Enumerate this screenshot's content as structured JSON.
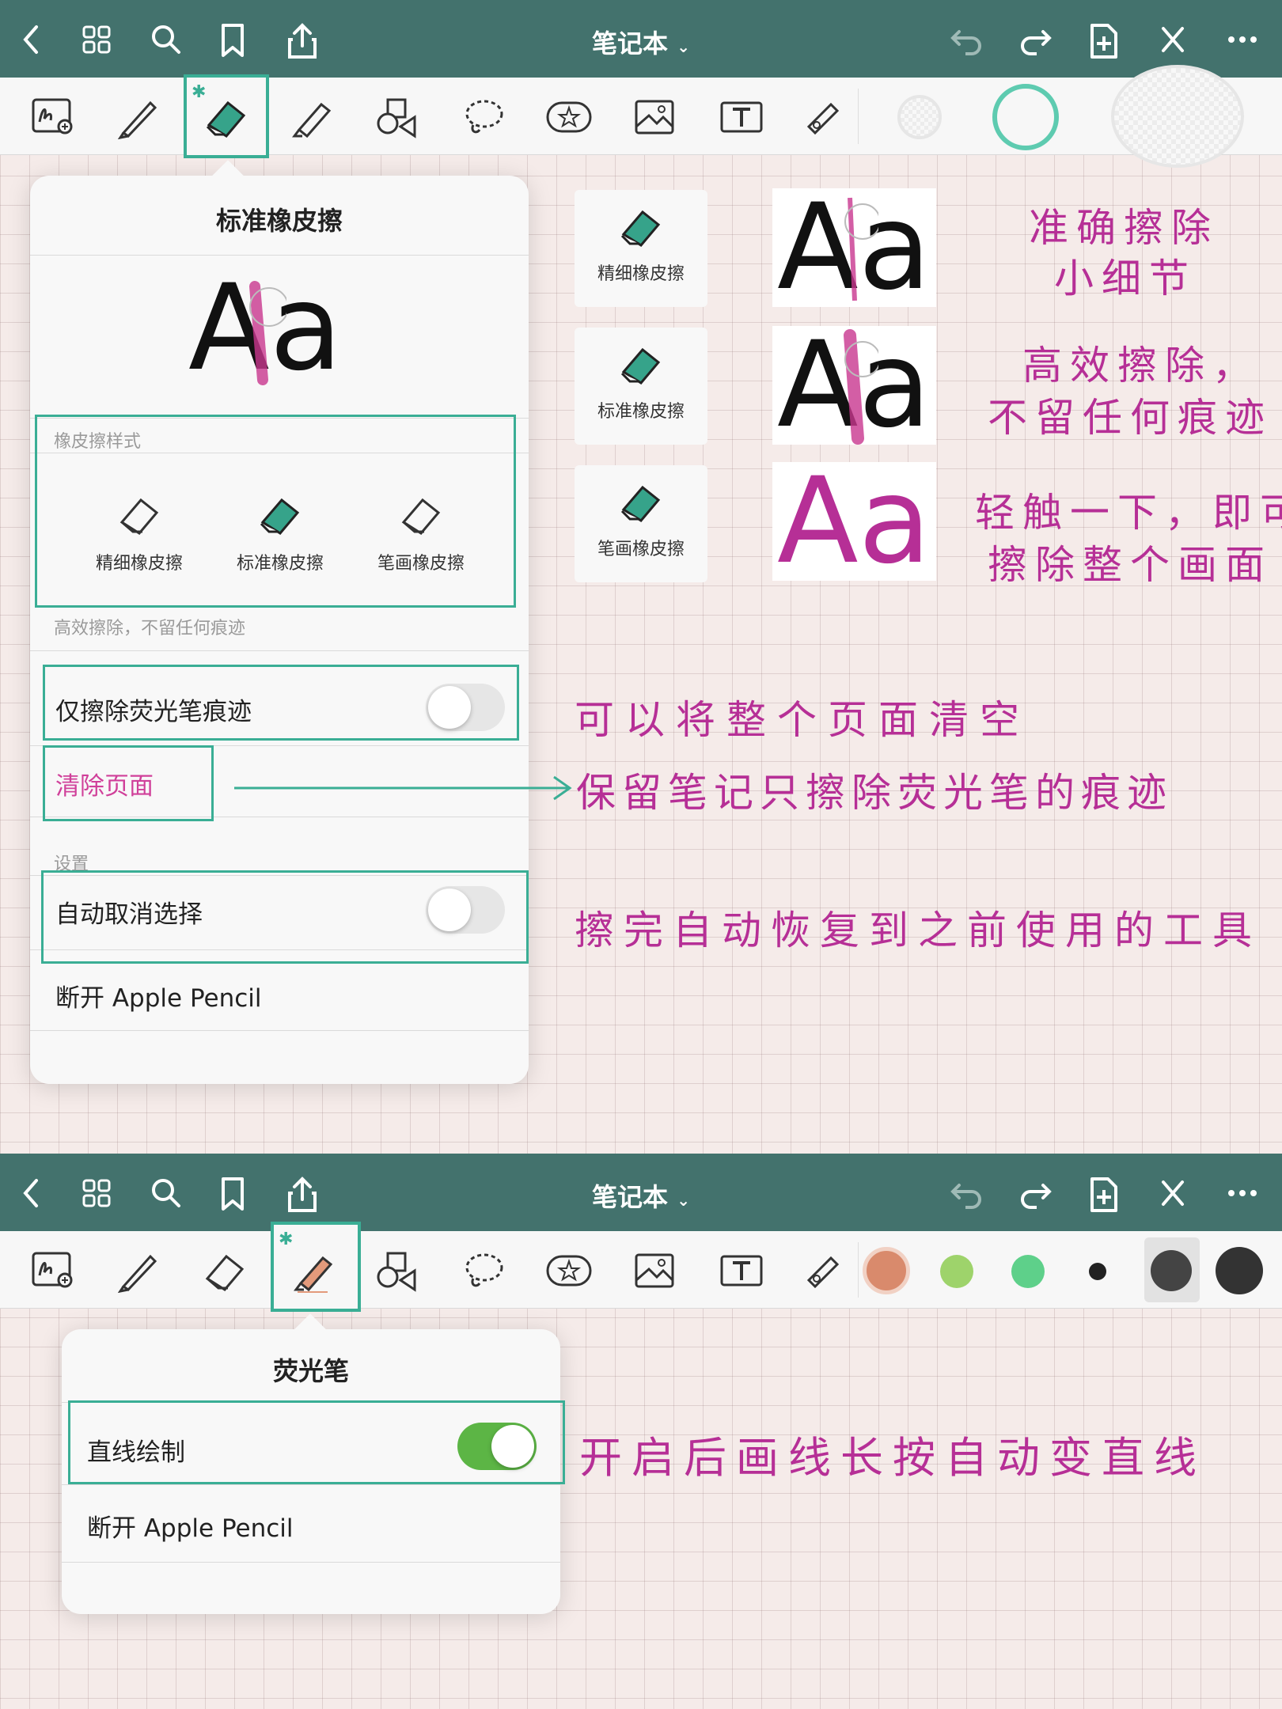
{
  "top": {
    "title": "笔记本",
    "icons": [
      "back-icon",
      "grid-icon",
      "search-icon",
      "bookmark-icon",
      "share-icon",
      "undo-icon",
      "redo-icon",
      "add-page-icon",
      "close-icon",
      "more-icon"
    ]
  },
  "eraser_panel": {
    "title": "标准橡皮擦",
    "preview_text": "Aa",
    "style_section_label": "橡皮擦样式",
    "options": [
      "精细橡皮擦",
      "标准橡皮擦",
      "笔画橡皮擦"
    ],
    "caption": "高效擦除，不留任何痕迹",
    "highlighter_only_label": "仅擦除荧光笔痕迹",
    "clear_page_label": "清除页面",
    "settings_label": "设置",
    "auto_deselect_label": "自动取消选择",
    "disconnect_label": "断开 Apple Pencil"
  },
  "cards": [
    {
      "label": "精细橡皮擦"
    },
    {
      "label": "标准橡皮擦"
    },
    {
      "label": "笔画橡皮擦"
    }
  ],
  "annotations": {
    "fine_1": "准确擦除",
    "fine_2": "小细节",
    "standard_1": "高效擦除，",
    "standard_2": "不留任何痕迹",
    "stroke_1": "轻触一下，即可",
    "stroke_2": "擦除整个画面",
    "clear_page": "可以将整个页面清空",
    "highlighter_only": "保留笔记只擦除荧光笔的痕迹",
    "auto_deselect": "擦完自动恢复到之前使用的工具",
    "straight_line": "开启后画线长按自动变直线"
  },
  "highlighter_panel": {
    "title": "荧光笔",
    "straight_line_label": "直线绘制",
    "straight_line_on": true,
    "disconnect_label": "断开 Apple Pencil"
  },
  "colors": {
    "accent": "#3aae95",
    "topbar": "#43726d",
    "annotation": "#b62f96",
    "toggle_on": "#5cb545",
    "swatches": [
      "#d98a6c",
      "#9ed36b",
      "#5ed08a",
      "#222222",
      "#444444",
      "#333333"
    ]
  }
}
